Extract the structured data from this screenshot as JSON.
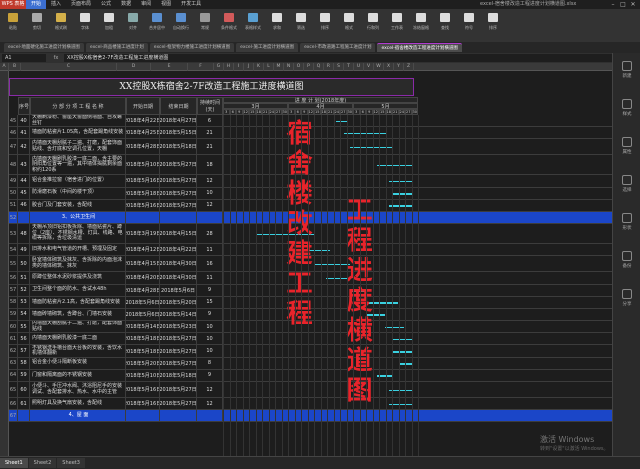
{
  "app": {
    "logo": "WPS 表格",
    "window_title": "excel-宿舍楼改造工程进度计划横道图.xlsx"
  },
  "menu": [
    "开始",
    "插入",
    "页面布局",
    "公式",
    "数据",
    "审阅",
    "视图",
    "开发工具"
  ],
  "ribbon": [
    {
      "label": "粘贴",
      "color": "#c9a23a",
      "icon": "paste-icon"
    },
    {
      "label": "剪切",
      "color": "#aaaaaa",
      "icon": "cut-icon"
    },
    {
      "label": "格式刷",
      "color": "#d4b04a",
      "icon": "format-painter-icon"
    },
    {
      "label": "字体",
      "color": "#ddd",
      "icon": "font-icon"
    },
    {
      "label": "加粗",
      "color": "#ddd",
      "icon": "bold-icon"
    },
    {
      "label": "对齐",
      "color": "#8aa",
      "icon": "align-icon"
    },
    {
      "label": "合并居中",
      "color": "#5a8fd0",
      "icon": "merge-icon"
    },
    {
      "label": "自动换行",
      "color": "#5a8fd0",
      "icon": "wrap-icon"
    },
    {
      "label": "常规",
      "color": "#999",
      "icon": "number-format-icon"
    },
    {
      "label": "条件格式",
      "color": "#d25a5a",
      "icon": "conditional-icon"
    },
    {
      "label": "表格样式",
      "color": "#5aa0d2",
      "icon": "table-style-icon"
    },
    {
      "label": "求和",
      "color": "#ddd",
      "icon": "sum-icon"
    },
    {
      "label": "筛选",
      "color": "#ddd",
      "icon": "filter-icon"
    },
    {
      "label": "排序",
      "color": "#ddd",
      "icon": "sort-icon"
    },
    {
      "label": "格式",
      "color": "#ddd",
      "icon": "format-icon"
    },
    {
      "label": "行和列",
      "color": "#ddd",
      "icon": "row-col-icon"
    },
    {
      "label": "工作表",
      "color": "#ddd",
      "icon": "sheet-icon"
    },
    {
      "label": "冻结窗格",
      "color": "#ddd",
      "icon": "freeze-icon"
    },
    {
      "label": "查找",
      "color": "#ddd",
      "icon": "find-icon"
    },
    {
      "label": "符号",
      "color": "#ddd",
      "icon": "symbol-icon"
    },
    {
      "label": "排序",
      "color": "#ddd",
      "icon": "sort2-icon"
    }
  ],
  "doc_tabs": [
    {
      "label": "excel-地面硬化施工进度计划横道图",
      "active": false
    },
    {
      "label": "excel-商品楼施工进度计划",
      "active": false
    },
    {
      "label": "excel-框架物力楼施工进度计划横道图",
      "active": false
    },
    {
      "label": "excel-施工进度计划横道图",
      "active": false
    },
    {
      "label": "excel-市政道路工程施工进度计划",
      "active": false
    },
    {
      "label": "excel-宿舍楼改造工程进度计划横道图",
      "active": true
    }
  ],
  "formula_bar": {
    "cell": "A1",
    "fx": "fx",
    "content": "XX控股X栋宿舍2-7F改造工程施工进度横道图"
  },
  "columns": [
    "A",
    "B",
    "C",
    "D",
    "E",
    "F",
    "G",
    "H",
    "I",
    "J",
    "K",
    "L",
    "M",
    "N",
    "O",
    "P",
    "Q",
    "R",
    "S",
    "T",
    "U",
    "V",
    "W",
    "X",
    "Y",
    "Z"
  ],
  "sheet": {
    "title": "XX控股X栋宿舍2-7F改造工程施工进度横道图",
    "headers": {
      "seq": "序号",
      "name": "分 部 分 项 工 程 名 称",
      "start": "开始日期",
      "end": "结束日期",
      "dur": "持续时间(天)",
      "plan": "进 度 计 划(2018年度)",
      "m3": "3月",
      "m4": "4月",
      "m5": "5月"
    },
    "days": [
      "3",
      "6",
      "9",
      "12",
      "15",
      "18",
      "21",
      "24",
      "27",
      "30",
      "3",
      "6",
      "9",
      "12",
      "15",
      "18",
      "21",
      "24",
      "27",
      "30",
      "3",
      "6",
      "9",
      "12",
      "15",
      "18",
      "21",
      "24",
      "27",
      "30"
    ],
    "rows": [
      {
        "n": "45",
        "seq": "40",
        "name": "天棚刷漆粉、窗座天窗面侧墙面、自攻螺丝钉",
        "start": "2018年4月22日",
        "end": "2018年4月27日",
        "dur": "6",
        "bar": [
          0.58,
          0.64
        ]
      },
      {
        "n": "46",
        "seq": "41",
        "name": "墙面防粘瓷片1.05高，含配套踢角线安装",
        "start": "2018年4月25日",
        "end": "2018年5月15日",
        "dur": "21",
        "bar": [
          0.62,
          0.84
        ]
      },
      {
        "n": "47",
        "seq": "42",
        "name": "内墙面天棚刮腻子二遍、打磨，配套饰面贴线、含灯底和空调孔位置，天棚",
        "start": "2018年4月28日",
        "end": "2018年5月18日",
        "dur": "21",
        "bar": [
          0.65,
          0.87
        ]
      },
      {
        "n": "48",
        "seq": "43",
        "name": "内墙面天棚刷乳胶漆一底二面，含主要的阴阳角位置等一遍，其中墙体揭腻剩余面积约120系",
        "start": "2018年5月10日",
        "end": "2018年5月27日",
        "dur": "18",
        "bar": [
          0.79,
          0.97
        ]
      },
      {
        "n": "49",
        "seq": "44",
        "name": "铝合金推拉窗（宿舍进门的位置）",
        "start": "2018年5月16日",
        "end": "2018年5月27日",
        "dur": "12",
        "bar": [
          0.85,
          0.97
        ]
      },
      {
        "n": "50",
        "seq": "45",
        "name": "防滑磨石板（中间的楼干顶）",
        "start": "2018年5月18日",
        "end": "2018年5月27日",
        "dur": "10",
        "bar": [
          0.87,
          0.97
        ]
      },
      {
        "n": "51",
        "seq": "46",
        "name": "胶合门及门套安装，含配线",
        "start": "2018年5月16日",
        "end": "2018年5月27日",
        "dur": "12",
        "bar": [
          0.85,
          0.97
        ]
      },
      {
        "n": "52",
        "seq": "",
        "name": "3、公共卫生间",
        "start": "",
        "end": "",
        "dur": "",
        "section": true
      },
      {
        "n": "53",
        "seq": "48",
        "name": "天棚吊顶旧铝扣板拆除、墙面贴瓷片、蹲位（2座）、不锈钢水槽、灯具、线路、电缆等拆除，含垃圾清运",
        "start": "2018年3月19日",
        "end": "2018年4月15日",
        "dur": "28",
        "bar": [
          0.17,
          0.47
        ]
      },
      {
        "n": "54",
        "seq": "49",
        "name": "旧排水和电气管道的开槽、预埋及固定",
        "start": "2018年4月12日",
        "end": "2018年4月22日",
        "dur": "11",
        "bar": [
          0.43,
          0.55
        ]
      },
      {
        "n": "55",
        "seq": "50",
        "name": "卧室墙体砌筑及抹灰、含拆除的内面泡沫类的墙体砌筑、抹灰",
        "start": "2018年4月15日",
        "end": "2018年4月30日",
        "dur": "16",
        "bar": [
          0.47,
          0.65
        ]
      },
      {
        "n": "56",
        "seq": "51",
        "name": "原蹲位整体水泥砂浆提供及浇筑",
        "start": "2018年4月20日",
        "end": "2018年4月30日",
        "dur": "11",
        "bar": [
          0.53,
          0.65
        ]
      },
      {
        "n": "57",
        "seq": "52",
        "name": "卫生间整个面的防水、含试水48h",
        "start": "2018年4月28日",
        "end": "2018年5月6日",
        "dur": "9",
        "bar": [
          0.65,
          0.74
        ]
      },
      {
        "n": "58",
        "seq": "53",
        "name": "墙面防粘瓷片2.1高，含配套踢角线安装",
        "start": "2018年5月6日",
        "end": "2018年5月20日",
        "dur": "15",
        "bar": [
          0.74,
          0.9
        ]
      },
      {
        "n": "59",
        "seq": "54",
        "name": "墙面砖墙砌筑，含蹲台、门墙石安装",
        "start": "2018年5月6日",
        "end": "2018年5月14日",
        "dur": "9",
        "bar": [
          0.74,
          0.83
        ]
      },
      {
        "n": "60",
        "seq": "55",
        "name": "内墙面天棚刮腻子二遍、打磨，配套饰面贴线",
        "start": "2018年5月14日",
        "end": "2018年5月23日",
        "dur": "10",
        "bar": [
          0.83,
          0.93
        ]
      },
      {
        "n": "61",
        "seq": "56",
        "name": "内墙面天棚刷乳胶漆一底二面",
        "start": "2018年5月18日",
        "end": "2018年5月27日",
        "dur": "10",
        "bar": [
          0.87,
          0.97
        ]
      },
      {
        "n": "62",
        "seq": "57",
        "name": "不锈钢洗手槽台面大台板的安装，含饮水机墙体翻新",
        "start": "2018年5月18日",
        "end": "2018年5月27日",
        "dur": "10",
        "bar": [
          0.87,
          0.97
        ]
      },
      {
        "n": "63",
        "seq": "58",
        "name": "铝合金小便斗隔断板安装",
        "start": "2018年5月20日",
        "end": "2018年5月27日",
        "dur": "8",
        "bar": [
          0.9,
          0.97
        ]
      },
      {
        "n": "64",
        "seq": "59",
        "name": "门窗和隔离面的不锈钢安装",
        "start": "2018年5月10日",
        "end": "2018年5月18日",
        "dur": "9",
        "bar": [
          0.79,
          0.87
        ]
      },
      {
        "n": "65",
        "seq": "60",
        "name": "小便斗、手压冲水阀、沐浴阻尼手的安装调试、含配套排水、热水、水中的主管",
        "start": "2018年5月16日",
        "end": "2018年5月27日",
        "dur": "12",
        "bar": [
          0.85,
          0.97
        ]
      },
      {
        "n": "66",
        "seq": "61",
        "name": "照明灯具及换气扇安装，含配线",
        "start": "2018年5月16日",
        "end": "2018年5月27日",
        "dur": "12",
        "bar": [
          0.85,
          0.97
        ]
      },
      {
        "n": "67",
        "seq": "",
        "name": "4、屋 面",
        "start": "",
        "end": "",
        "dur": "",
        "section": true
      }
    ]
  },
  "overlay": {
    "left": "宿舍楼改建工程",
    "right": "工程进度横道图",
    "color": "#e8242b"
  },
  "right_panel": [
    "新建",
    "样式",
    "属性",
    "选择",
    "形状",
    "备份",
    "分享"
  ],
  "sheet_tabs": [
    {
      "label": "Sheet1",
      "active": true
    },
    {
      "label": "Sheet2",
      "active": false
    },
    {
      "label": "Sheet3",
      "active": false
    }
  ],
  "watermark": {
    "line1": "激活 Windows",
    "line2": "转到\"设置\"以激活 Windows。"
  }
}
